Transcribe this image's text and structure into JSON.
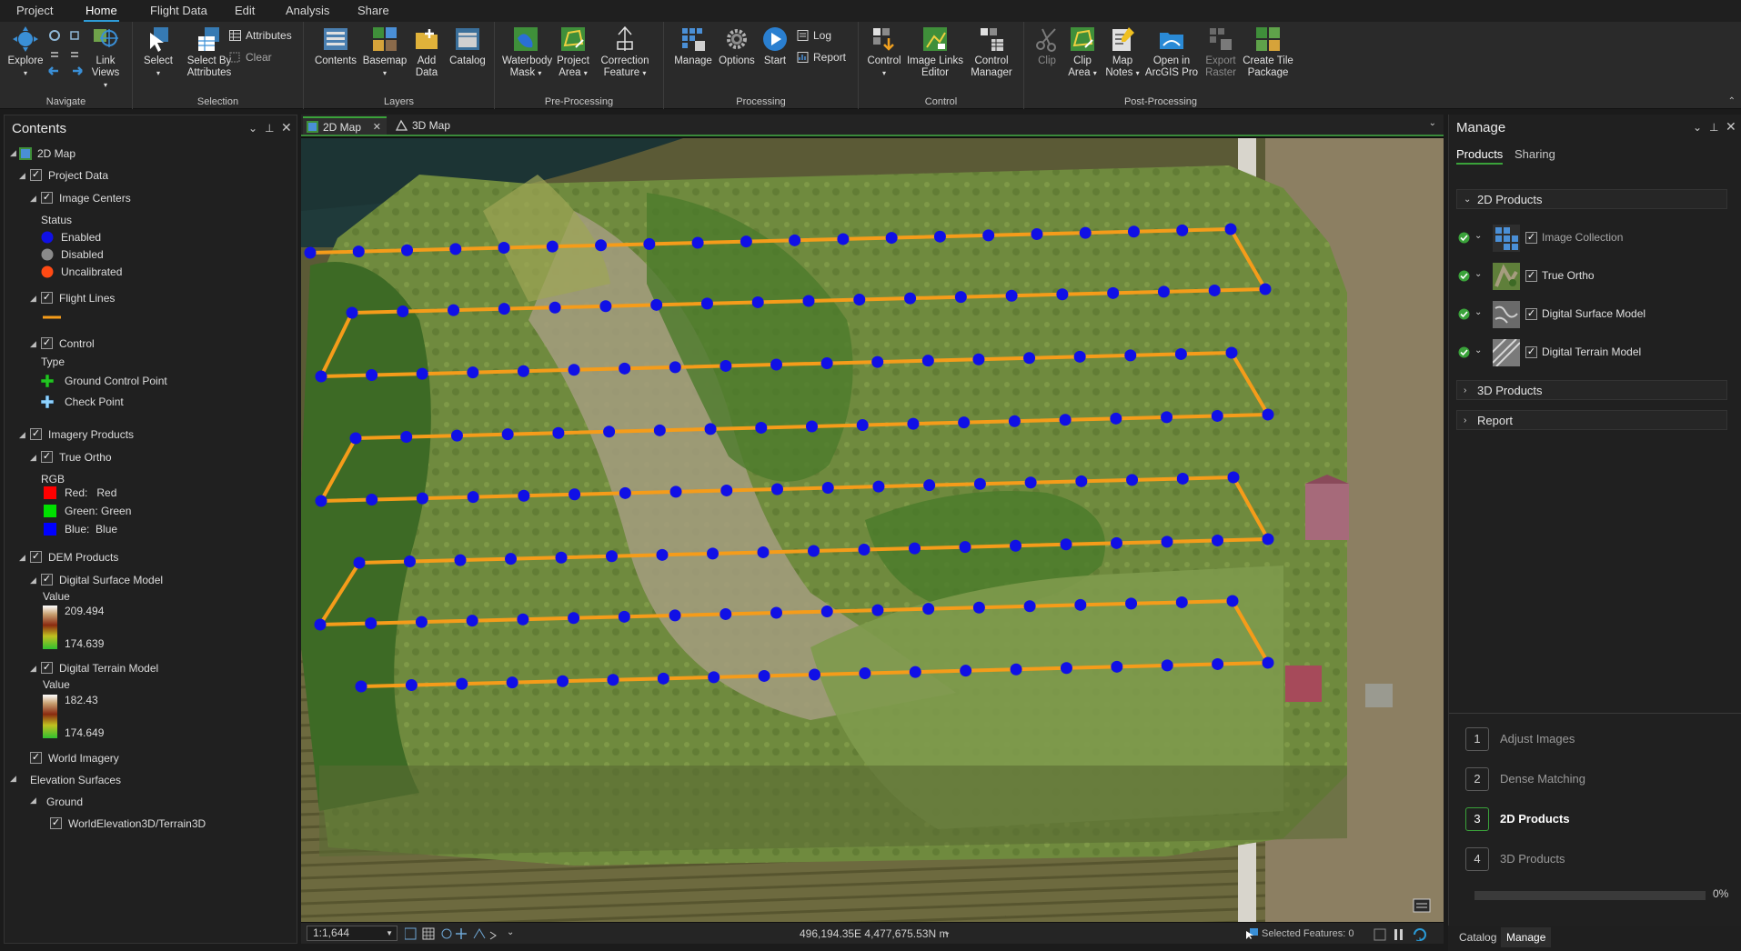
{
  "menu": {
    "tabs": [
      "Project",
      "Home",
      "Flight Data",
      "Edit",
      "Analysis",
      "Share"
    ],
    "active": "Home"
  },
  "ribbon": {
    "navigate": {
      "label": "Navigate",
      "explore": "Explore",
      "link_views": "Link Views"
    },
    "selection": {
      "label": "Selection",
      "select": "Select",
      "select_by_attributes": "Select By Attributes",
      "attributes": "Attributes",
      "clear": "Clear"
    },
    "layers": {
      "label": "Layers",
      "contents": "Contents",
      "basemap": "Basemap",
      "add_data": "Add Data",
      "catalog": "Catalog"
    },
    "preprocessing": {
      "label": "Pre-Processing",
      "waterbody_mask": "Waterbody Mask",
      "project_area": "Project Area",
      "correction_feature": "Correction Feature"
    },
    "processing": {
      "label": "Processing",
      "manage": "Manage",
      "options": "Options",
      "start": "Start",
      "log": "Log",
      "report": "Report"
    },
    "control": {
      "label": "Control",
      "control": "Control",
      "image_links_editor": "Image Links Editor",
      "control_manager": "Control Manager"
    },
    "postprocessing": {
      "label": "Post-Processing",
      "clip": "Clip",
      "clip_area": "Clip Area",
      "map_notes": "Map Notes",
      "open_in_arcgis_pro": "Open in ArcGIS Pro",
      "export_raster": "Export Raster",
      "create_tile_package": "Create Tile Package"
    }
  },
  "contents": {
    "title": "Contents",
    "map_name": "2D Map",
    "project_data": "Project Data",
    "image_centers": "Image Centers",
    "status_label": "Status",
    "status_items": [
      "Enabled",
      "Disabled",
      "Uncalibrated"
    ],
    "flight_lines": "Flight Lines",
    "control": "Control",
    "type_label": "Type",
    "control_items": [
      "Ground Control Point",
      "Check Point"
    ],
    "imagery_products": "Imagery Products",
    "true_ortho": "True Ortho",
    "rgb_label": "RGB",
    "rgb_items": [
      "Red:   Red",
      "Green: Green",
      "Blue:  Blue"
    ],
    "dem_products": "DEM Products",
    "dsm": "Digital Surface Model",
    "dsm_value_label": "Value",
    "dsm_max": "209.494",
    "dsm_min": "174.639",
    "dtm": "Digital Terrain Model",
    "dtm_value_label": "Value",
    "dtm_max": "182.43",
    "dtm_min": "174.649",
    "world_imagery": "World Imagery",
    "elevation_surfaces": "Elevation Surfaces",
    "ground": "Ground",
    "world_elevation": "WorldElevation3D/Terrain3D"
  },
  "map": {
    "tabs": [
      "2D Map",
      "3D Map"
    ],
    "active_tab": "2D Map"
  },
  "status": {
    "scale": "1:1,644",
    "coords": "496,194.35E 4,477,675.53N m",
    "selected_features": "Selected Features: 0"
  },
  "manage": {
    "title": "Manage",
    "tabs": [
      "Products",
      "Sharing"
    ],
    "active_tab": "Products",
    "sections": {
      "products_2d": "2D Products",
      "products_3d": "3D Products",
      "report": "Report"
    },
    "products": [
      "Image Collection",
      "True Ortho",
      "Digital Surface Model",
      "Digital Terrain Model"
    ],
    "steps": [
      {
        "num": "1",
        "label": "Adjust Images"
      },
      {
        "num": "2",
        "label": "Dense Matching"
      },
      {
        "num": "3",
        "label": "2D Products"
      },
      {
        "num": "4",
        "label": "3D Products"
      }
    ],
    "progress": "0%",
    "progress_value": 0
  },
  "bottom_tabs": [
    "Catalog",
    "Manage"
  ],
  "bottom_active": "Manage",
  "colors": {
    "accent": "#2e9bd6",
    "enabled": "#1010e6",
    "disabled": "#8a8a8a",
    "uncalibrated": "#ff4a14",
    "flight_line": "#f59c1a",
    "gcp": "#22c422",
    "checkpoint": "#8fd3ff",
    "complete": "#3aa23a"
  }
}
